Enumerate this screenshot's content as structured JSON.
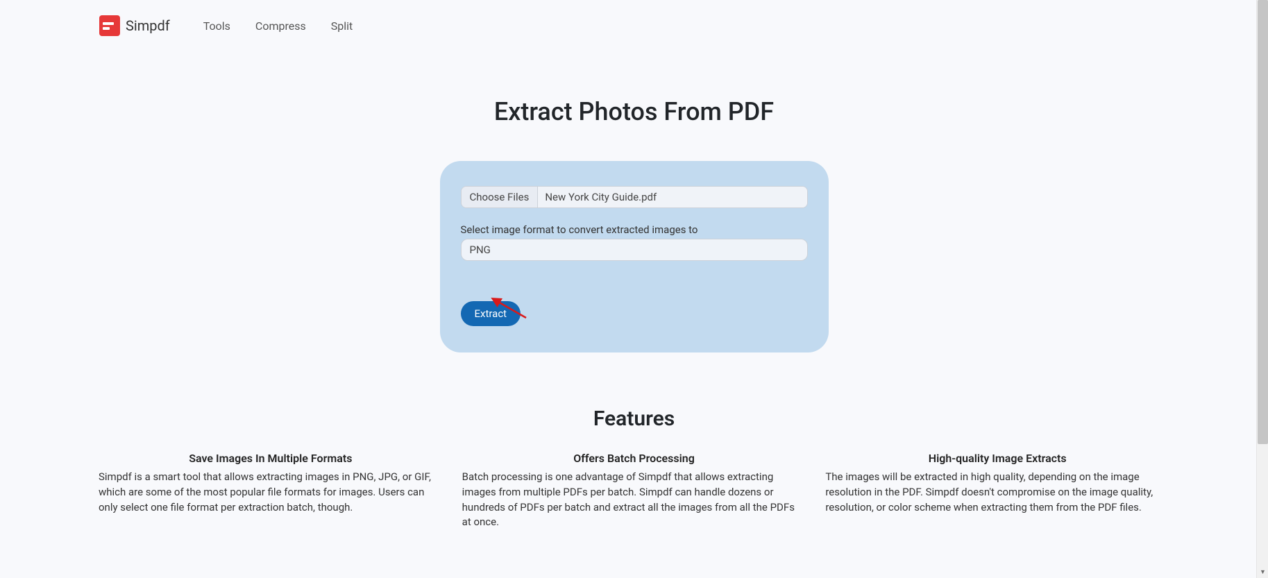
{
  "brand": {
    "name": "Simpdf"
  },
  "nav": {
    "tools": "Tools",
    "compress": "Compress",
    "split": "Split"
  },
  "page": {
    "title": "Extract Photos From PDF"
  },
  "form": {
    "choose_files_label": "Choose Files",
    "file_name": "New York City Guide.pdf",
    "format_label": "Select image format to convert extracted images to",
    "format_value": "PNG",
    "extract_label": "Extract"
  },
  "features": {
    "title": "Features",
    "items": [
      {
        "heading": "Save Images In Multiple Formats",
        "desc": "Simpdf is a smart tool that allows extracting images in PNG, JPG, or GIF, which are some of the most popular file formats for images. Users can only select one file format per extraction batch, though."
      },
      {
        "heading": "Offers Batch Processing",
        "desc": "Batch processing is one advantage of Simpdf that allows extracting images from multiple PDFs per batch. Simpdf can handle dozens or hundreds of PDFs per batch and extract all the images from all the PDFs at once."
      },
      {
        "heading": "High-quality Image Extracts",
        "desc": "The images will be extracted in high quality, depending on the image resolution in the PDF. Simpdf doesn't compromise on the image quality, resolution, or color scheme when extracting them from the PDF files."
      }
    ]
  }
}
